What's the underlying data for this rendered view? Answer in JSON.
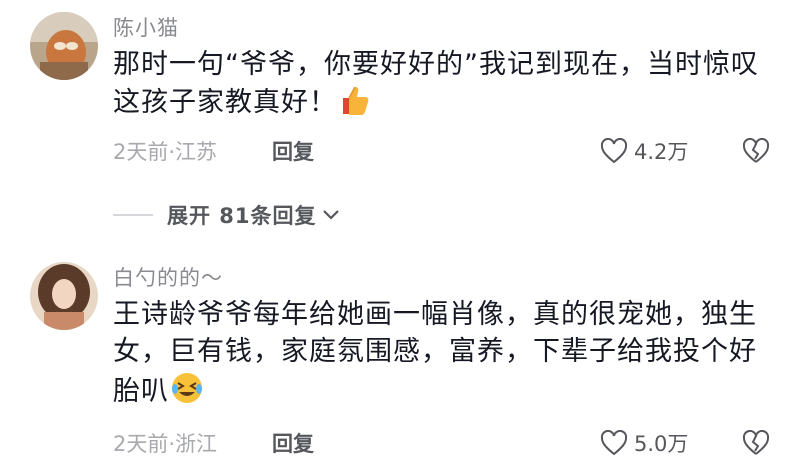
{
  "comments": [
    {
      "username": "陈小猫",
      "text_line1": "那时一句“爷爷，你要好好的”我记到现在，当时惊叹",
      "text_line2": "这孩子家教真好！",
      "emoji": "thumbs-up-icon",
      "meta": "2天前·江苏",
      "reply_label": "回复",
      "likes": "4.2万"
    },
    {
      "username": "白勺的的～",
      "text_line1": "王诗龄爷爷每年给她画一幅肖像，真的很宠她，独生",
      "text_line2": "女，巨有钱，家庭氛围感，富养，下辈子给我投个好",
      "text_line3": "胎叭",
      "emoji": "rolling-laughing-icon",
      "meta": "2天前·浙江",
      "reply_label": "回复",
      "likes": "5.0万"
    }
  ],
  "expand": {
    "label": "展开 81条回复"
  },
  "colors": {
    "text": "#161823",
    "muted": "#8a8b91",
    "meta": "#a8a9ae"
  }
}
